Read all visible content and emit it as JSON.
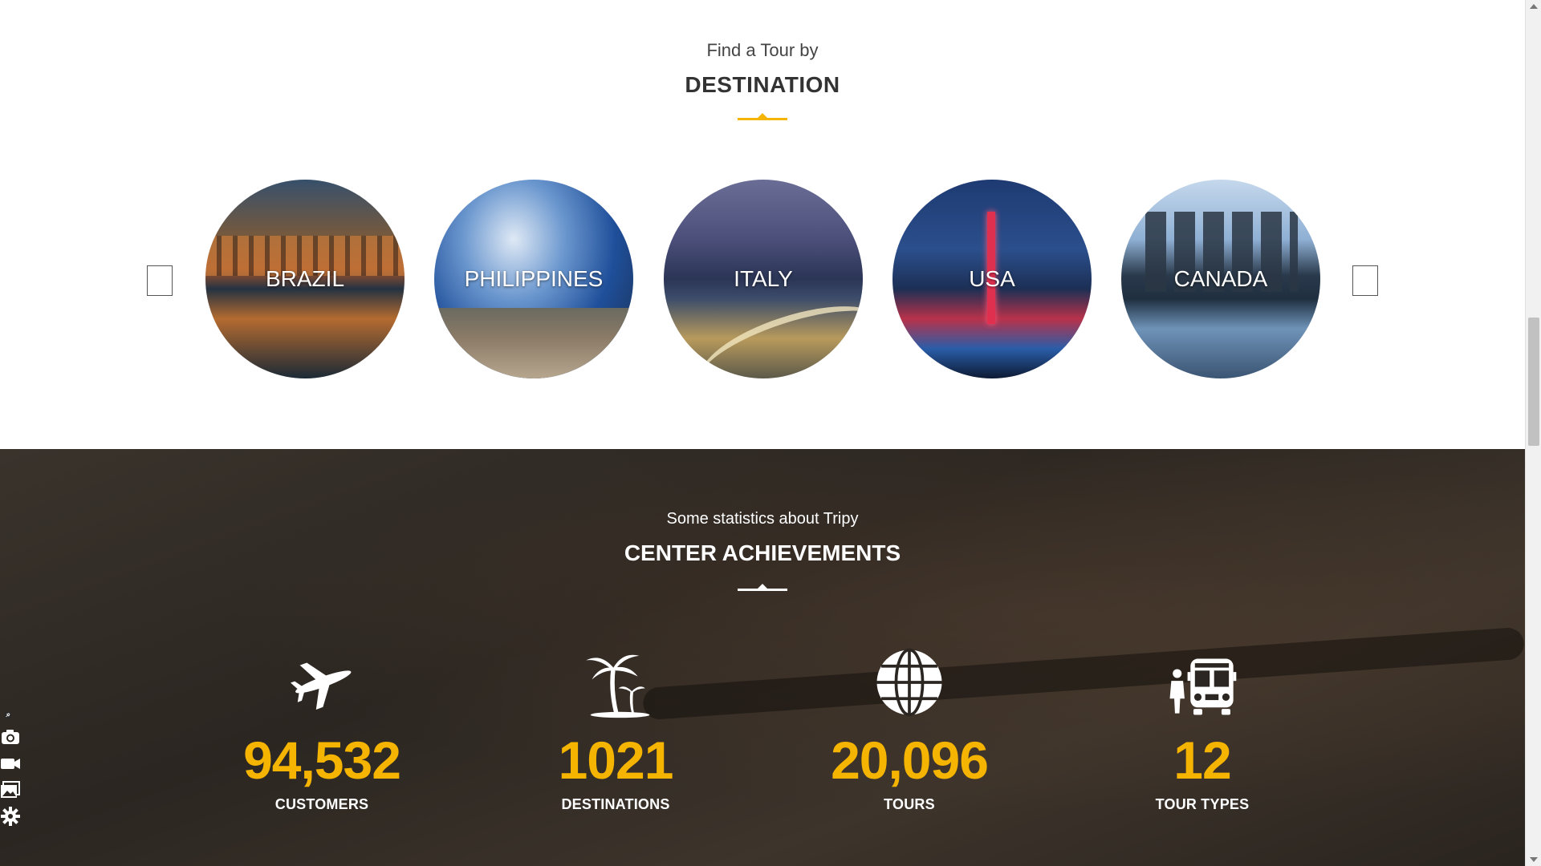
{
  "destination_section": {
    "kicker": "Find a Tour by",
    "heading": "DESTINATION",
    "accent_color": "#f5b400",
    "items": [
      {
        "label": "BRAZIL"
      },
      {
        "label": "PHILIPPINES"
      },
      {
        "label": "ITALY"
      },
      {
        "label": "USA"
      },
      {
        "label": "CANADA"
      }
    ]
  },
  "achievements_section": {
    "kicker": "Some statistics about Tripy",
    "heading": "CENTER ACHIEVEMENTS",
    "number_color": "#f5b400",
    "stats": [
      {
        "icon": "airplane-icon",
        "value": "94,532",
        "caption": "CUSTOMERS"
      },
      {
        "icon": "palm-tree-icon",
        "value": "1021",
        "caption": "DESTINATIONS"
      },
      {
        "icon": "globe-icon",
        "value": "20,096",
        "caption": "TOURS"
      },
      {
        "icon": "tour-bus-icon",
        "value": "12",
        "caption": "TOUR TYPES"
      }
    ]
  },
  "tool_dock": {
    "icons": [
      "pin-icon",
      "camera-icon",
      "video-icon",
      "gallery-icon",
      "gear-icon"
    ]
  }
}
